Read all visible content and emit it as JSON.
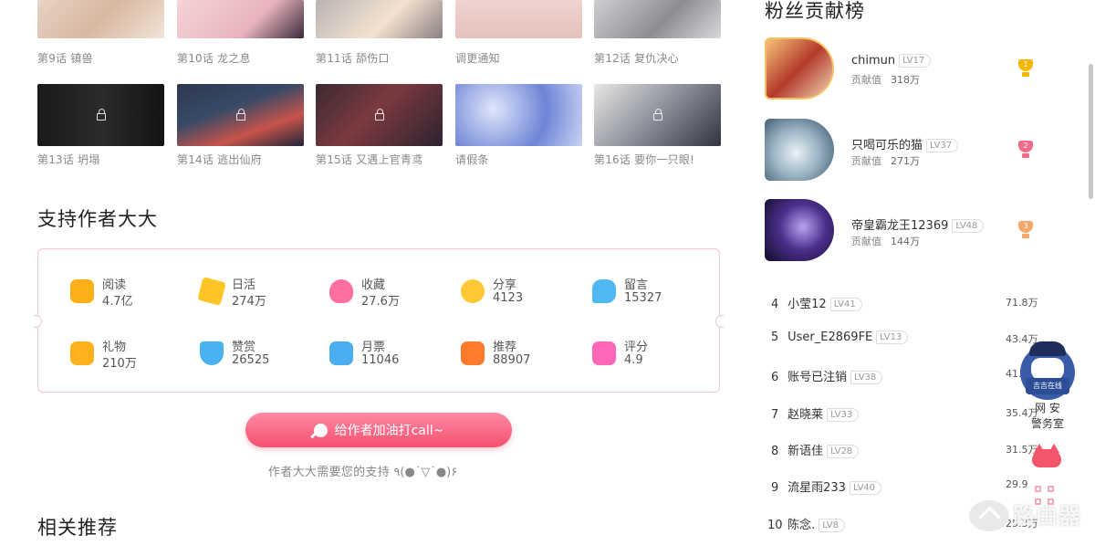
{
  "episodes": [
    {
      "title": "第9话 镇兽",
      "locked": false
    },
    {
      "title": "第10话 龙之息",
      "locked": false
    },
    {
      "title": "第11话 舔伤口",
      "locked": false
    },
    {
      "title": "调更通知",
      "locked": false
    },
    {
      "title": "第12话 复仇决心",
      "locked": false
    },
    {
      "title": "第13话 坍塌",
      "locked": true
    },
    {
      "title": "第14话 逃出仙府",
      "locked": true
    },
    {
      "title": "第15话 又遇上官青鸢",
      "locked": true
    },
    {
      "title": "请假条",
      "locked": false
    },
    {
      "title": "第16话 要你一只眼!",
      "locked": true
    }
  ],
  "support": {
    "title": "支持作者大大",
    "stats": [
      {
        "label": "阅读",
        "value": "4.7亿",
        "icon": "read-icon",
        "color": "#ffb019"
      },
      {
        "label": "日活",
        "value": "274万",
        "icon": "star-icon",
        "color": "#ffc526"
      },
      {
        "label": "收藏",
        "value": "27.6万",
        "icon": "heart-icon",
        "color": "#ff6fa2"
      },
      {
        "label": "分享",
        "value": "4123",
        "icon": "share-icon",
        "color": "#ffc733"
      },
      {
        "label": "留言",
        "value": "15327",
        "icon": "comment-icon",
        "color": "#4fb8f2"
      },
      {
        "label": "礼物",
        "value": "210万",
        "icon": "gift-icon",
        "color": "#ffb21c"
      },
      {
        "label": "赞赏",
        "value": "26525",
        "icon": "diamond-icon",
        "color": "#48b3f0"
      },
      {
        "label": "月票",
        "value": "11046",
        "icon": "ticket-icon",
        "color": "#4aaef0"
      },
      {
        "label": "推荐",
        "value": "88907",
        "icon": "recommend-icon",
        "color": "#ff7a2d"
      },
      {
        "label": "评分",
        "value": "4.9",
        "icon": "rating-icon",
        "color": "#ff66b8"
      }
    ],
    "button_label": "给作者加油打call~",
    "sub_text": "作者大大需要您的支持 ٩(●˙▽˙●)۶"
  },
  "related": {
    "title": "相关推荐"
  },
  "fans": {
    "title": "粉丝贡献榜",
    "contrib_label": "贡献值",
    "top": [
      {
        "rank": "1",
        "name": "chimun",
        "level": "LV17",
        "value": "318万",
        "trophy_color": "#f5b800"
      },
      {
        "rank": "2",
        "name": "只喝可乐的猫",
        "level": "LV37",
        "value": "271万",
        "trophy_color": "#f06c8a"
      },
      {
        "rank": "3",
        "name": "帝皇霸龙王12369",
        "level": "LV48",
        "value": "144万",
        "trophy_color": "#f5a66b"
      }
    ],
    "list": [
      {
        "rank": "4",
        "name": "小莹12",
        "level": "LV41",
        "value": "71.8万"
      },
      {
        "rank": "5",
        "name": "User_E2869FE",
        "level": "LV13",
        "value": "43.4万"
      },
      {
        "rank": "6",
        "name": "账号已注销",
        "level": "LV38",
        "value": "41."
      },
      {
        "rank": "7",
        "name": "赵晓莱",
        "level": "LV33",
        "value": "35.4万"
      },
      {
        "rank": "8",
        "name": "新语佳",
        "level": "LV28",
        "value": "31.5万"
      },
      {
        "rank": "9",
        "name": "流星雨233",
        "level": "LV40",
        "value": "29.9"
      },
      {
        "rank": "10",
        "name": "陈念.",
        "level": "LV8",
        "value": "25.3万"
      }
    ]
  },
  "floating": {
    "police_sign": "吉吉在线",
    "police_text_1": "网 安",
    "police_text_2": "警务室",
    "watermark": "路由器"
  }
}
